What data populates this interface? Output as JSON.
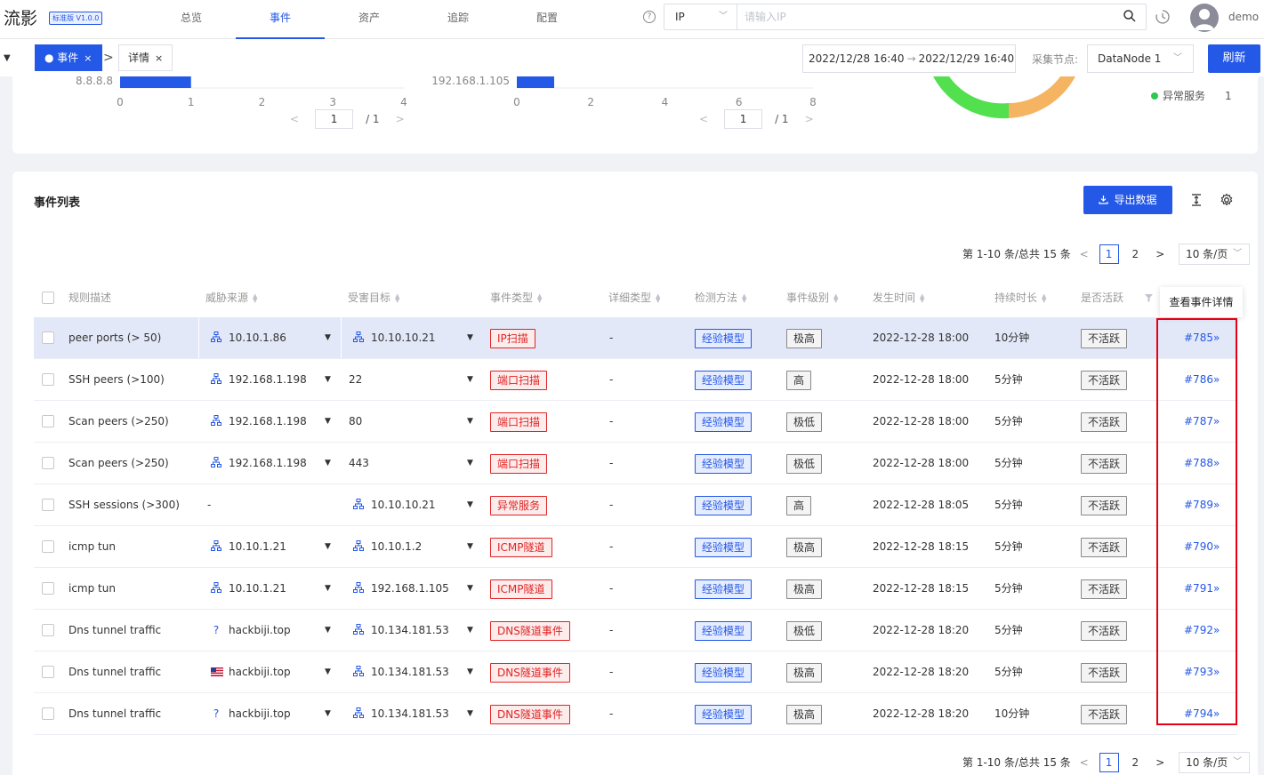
{
  "header": {
    "logo": "流影",
    "version": "标准版 V1.0.0",
    "nav": [
      {
        "label": "总览",
        "active": false
      },
      {
        "label": "事件",
        "active": true
      },
      {
        "label": "资产",
        "active": false
      },
      {
        "label": "追踪",
        "active": false
      },
      {
        "label": "配置",
        "active": false
      }
    ],
    "help_glyph": "?",
    "search_type": "IP",
    "search_placeholder": "请输入IP",
    "username": "demo"
  },
  "tabs": {
    "items": [
      {
        "label": "● 事件",
        "close": "×",
        "active": true
      },
      {
        "label": "详情",
        "close": "×",
        "active": false
      }
    ],
    "date_start": "2022/12/28 16:40",
    "date_sep": "→",
    "date_end": "2022/12/29 16:40",
    "node_label": "采集节点:",
    "node_value": "DataNode 1",
    "refresh_label": "刷新"
  },
  "top_charts": {
    "left": {
      "category": "8.8.8.8",
      "value": 1,
      "xmax": 4,
      "ticks": [
        "0",
        "1",
        "2",
        "3",
        "4"
      ],
      "page": "1",
      "total": "/ 1"
    },
    "right": {
      "category": "192.168.1.105",
      "value": 0,
      "xmax": 8,
      "ticks": [
        "0",
        "2",
        "4",
        "6",
        "8"
      ],
      "page": "1",
      "total": "/ 1"
    },
    "legend": {
      "label": "异常服务",
      "value": "1",
      "color": "#2ec752"
    },
    "donut_colors": {
      "green": "#52e04f",
      "orange": "#f5b461"
    }
  },
  "event_list": {
    "title": "事件列表",
    "export_label": "导出数据",
    "pager_summary": "第 1-10 条/总共 15 条",
    "pages": [
      "1",
      "2"
    ],
    "page_size": "10 条/页",
    "columns": [
      "规则描述",
      "威胁来源",
      "受害目标",
      "事件类型",
      "详细类型",
      "检测方法",
      "事件级别",
      "发生时间",
      "持续时长",
      "是否活跃"
    ],
    "tooltip": "查看事件详情",
    "rows": [
      {
        "rule": "peer ports (> 50)",
        "src_icon": "net",
        "src": "10.10.1.86",
        "dst_icon": "net",
        "dst": "10.10.10.21",
        "type": "IP扫描",
        "detail": "-",
        "method": "经验模型",
        "level": "极高",
        "time": "2022-12-28 18:00",
        "duration": "10分钟",
        "active": "不活跃",
        "id": "#785»",
        "highlight": true
      },
      {
        "rule": "SSH peers (>100)",
        "src_icon": "net",
        "src": "192.168.1.198",
        "dst_icon": "",
        "dst": "22",
        "type": "端口扫描",
        "detail": "-",
        "method": "经验模型",
        "level": "高",
        "time": "2022-12-28 18:00",
        "duration": "5分钟",
        "active": "不活跃",
        "id": "#786»",
        "highlight": false
      },
      {
        "rule": "Scan peers (>250)",
        "src_icon": "net",
        "src": "192.168.1.198",
        "dst_icon": "",
        "dst": "80",
        "type": "端口扫描",
        "detail": "-",
        "method": "经验模型",
        "level": "极低",
        "time": "2022-12-28 18:00",
        "duration": "5分钟",
        "active": "不活跃",
        "id": "#787»",
        "highlight": false
      },
      {
        "rule": "Scan peers (>250)",
        "src_icon": "net",
        "src": "192.168.1.198",
        "dst_icon": "",
        "dst": "443",
        "type": "端口扫描",
        "detail": "-",
        "method": "经验模型",
        "level": "极低",
        "time": "2022-12-28 18:00",
        "duration": "5分钟",
        "active": "不活跃",
        "id": "#788»",
        "highlight": false
      },
      {
        "rule": "SSH sessions (>300)",
        "src_icon": "",
        "src": "-",
        "dst_icon": "net",
        "dst": "10.10.10.21",
        "type": "异常服务",
        "detail": "-",
        "method": "经验模型",
        "level": "高",
        "time": "2022-12-28 18:05",
        "duration": "5分钟",
        "active": "不活跃",
        "id": "#789»",
        "highlight": false
      },
      {
        "rule": "icmp tun",
        "src_icon": "net",
        "src": "10.10.1.21",
        "dst_icon": "net",
        "dst": "10.10.1.2",
        "type": "ICMP隧道",
        "detail": "-",
        "method": "经验模型",
        "level": "极高",
        "time": "2022-12-28 18:15",
        "duration": "5分钟",
        "active": "不活跃",
        "id": "#790»",
        "highlight": false
      },
      {
        "rule": "icmp tun",
        "src_icon": "net",
        "src": "10.10.1.21",
        "dst_icon": "net",
        "dst": "192.168.1.105",
        "type": "ICMP隧道",
        "detail": "-",
        "method": "经验模型",
        "level": "极高",
        "time": "2022-12-28 18:15",
        "duration": "5分钟",
        "active": "不活跃",
        "id": "#791»",
        "highlight": false
      },
      {
        "rule": "Dns tunnel traffic",
        "src_icon": "question",
        "src": "hackbiji.top",
        "dst_icon": "net",
        "dst": "10.134.181.53",
        "type": "DNS隧道事件",
        "detail": "-",
        "method": "经验模型",
        "level": "极低",
        "time": "2022-12-28 18:20",
        "duration": "5分钟",
        "active": "不活跃",
        "id": "#792»",
        "highlight": false
      },
      {
        "rule": "Dns tunnel traffic",
        "src_icon": "us-flag",
        "src": "hackbiji.top",
        "dst_icon": "net",
        "dst": "10.134.181.53",
        "type": "DNS隧道事件",
        "detail": "-",
        "method": "经验模型",
        "level": "极高",
        "time": "2022-12-28 18:20",
        "duration": "5分钟",
        "active": "不活跃",
        "id": "#793»",
        "highlight": false
      },
      {
        "rule": "Dns tunnel traffic",
        "src_icon": "question",
        "src": "hackbiji.top",
        "dst_icon": "net",
        "dst": "10.134.181.53",
        "type": "DNS隧道事件",
        "detail": "-",
        "method": "经验模型",
        "level": "极高",
        "time": "2022-12-28 18:20",
        "duration": "10分钟",
        "active": "不活跃",
        "id": "#794»",
        "highlight": false
      }
    ]
  }
}
